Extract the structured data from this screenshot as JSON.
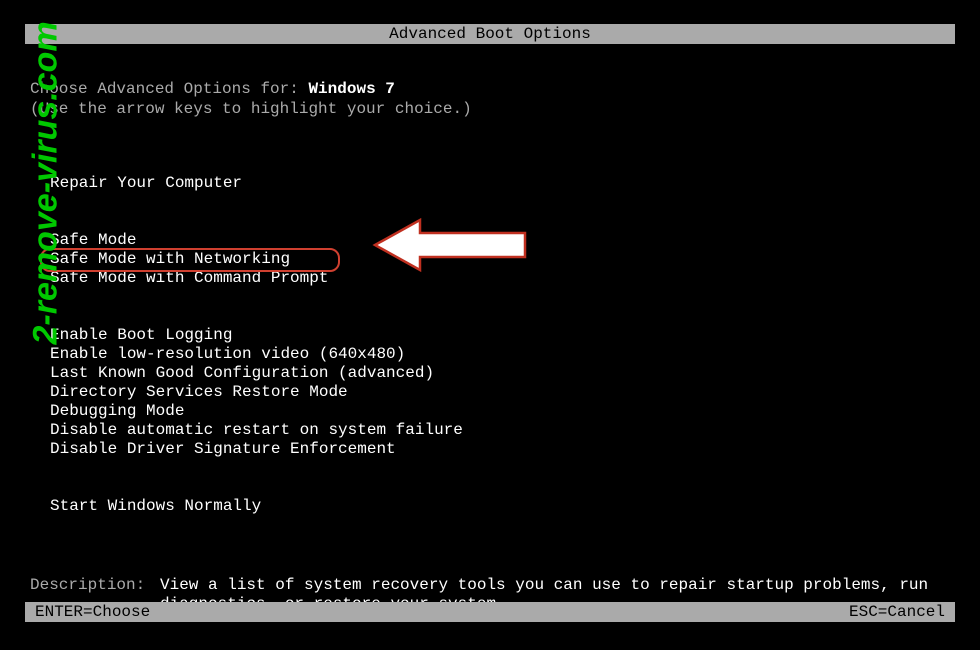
{
  "title": "Advanced Boot Options",
  "choose_label": "Choose Advanced Options for: ",
  "os_name": "Windows 7",
  "instruction": "(Use the arrow keys to highlight your choice.)",
  "menu": {
    "repair": "Repair Your Computer",
    "safe_mode": "Safe Mode",
    "safe_mode_net": "Safe Mode with Networking",
    "safe_mode_cmd": "Safe Mode with Command Prompt",
    "boot_logging": "Enable Boot Logging",
    "low_res": "Enable low-resolution video (640x480)",
    "last_known": "Last Known Good Configuration (advanced)",
    "ds_restore": "Directory Services Restore Mode",
    "debugging": "Debugging Mode",
    "disable_restart": "Disable automatic restart on system failure",
    "disable_sig": "Disable Driver Signature Enforcement",
    "start_normal": "Start Windows Normally"
  },
  "description": {
    "label": "Description:",
    "text": "View a list of system recovery tools you can use to repair startup problems, run diagnostics, or restore your system."
  },
  "footer": {
    "enter": "ENTER=Choose",
    "esc": "ESC=Cancel"
  },
  "watermark": "2-remove-virus.com"
}
